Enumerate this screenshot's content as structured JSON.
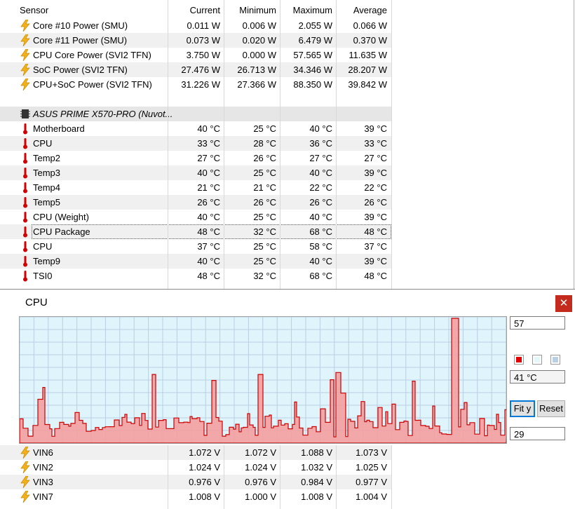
{
  "header": {
    "sensor": "Sensor",
    "current": "Current",
    "minimum": "Minimum",
    "maximum": "Maximum",
    "average": "Average"
  },
  "power_rows": [
    {
      "name": "Core #10 Power (SMU)",
      "current": "0.011 W",
      "minimum": "0.006 W",
      "maximum": "2.055 W",
      "average": "0.066 W",
      "icon": "lightning-icon"
    },
    {
      "name": "Core #11 Power (SMU)",
      "current": "0.073 W",
      "minimum": "0.020 W",
      "maximum": "6.479 W",
      "average": "0.370 W",
      "icon": "lightning-icon"
    },
    {
      "name": "CPU Core Power (SVI2 TFN)",
      "current": "3.750 W",
      "minimum": "0.000 W",
      "maximum": "57.565 W",
      "average": "11.635 W",
      "icon": "lightning-icon"
    },
    {
      "name": "SoC Power (SVI2 TFN)",
      "current": "27.476 W",
      "minimum": "26.713 W",
      "maximum": "34.346 W",
      "average": "28.207 W",
      "icon": "lightning-icon"
    },
    {
      "name": "CPU+SoC Power (SVI2 TFN)",
      "current": "31.226 W",
      "minimum": "27.366 W",
      "maximum": "88.350 W",
      "average": "39.842 W",
      "icon": "lightning-icon"
    }
  ],
  "group": {
    "name": "ASUS PRIME X570-PRO (Nuvot...",
    "icon": "chip-icon"
  },
  "temp_rows": [
    {
      "name": "Motherboard",
      "current": "40 °C",
      "minimum": "25 °C",
      "maximum": "40 °C",
      "average": "39 °C",
      "icon": "thermometer-icon"
    },
    {
      "name": "CPU",
      "current": "33 °C",
      "minimum": "28 °C",
      "maximum": "36 °C",
      "average": "33 °C",
      "icon": "thermometer-icon"
    },
    {
      "name": "Temp2",
      "current": "27 °C",
      "minimum": "26 °C",
      "maximum": "27 °C",
      "average": "27 °C",
      "icon": "thermometer-icon"
    },
    {
      "name": "Temp3",
      "current": "40 °C",
      "minimum": "25 °C",
      "maximum": "40 °C",
      "average": "39 °C",
      "icon": "thermometer-icon"
    },
    {
      "name": "Temp4",
      "current": "21 °C",
      "minimum": "21 °C",
      "maximum": "22 °C",
      "average": "22 °C",
      "icon": "thermometer-icon"
    },
    {
      "name": "Temp5",
      "current": "26 °C",
      "minimum": "26 °C",
      "maximum": "26 °C",
      "average": "26 °C",
      "icon": "thermometer-icon"
    },
    {
      "name": "CPU (Weight)",
      "current": "40 °C",
      "minimum": "25 °C",
      "maximum": "40 °C",
      "average": "39 °C",
      "icon": "thermometer-icon"
    },
    {
      "name": "CPU Package",
      "current": "48 °C",
      "minimum": "32 °C",
      "maximum": "68 °C",
      "average": "48 °C",
      "icon": "thermometer-icon"
    },
    {
      "name": "CPU",
      "current": "37 °C",
      "minimum": "25 °C",
      "maximum": "58 °C",
      "average": "37 °C",
      "icon": "thermometer-icon"
    },
    {
      "name": "Temp9",
      "current": "40 °C",
      "minimum": "25 °C",
      "maximum": "40 °C",
      "average": "39 °C",
      "icon": "thermometer-icon"
    },
    {
      "name": "TSI0",
      "current": "48 °C",
      "minimum": "32 °C",
      "maximum": "68 °C",
      "average": "48 °C",
      "icon": "thermometer-icon"
    }
  ],
  "graph": {
    "title": "CPU",
    "close": "✕",
    "max_value": "57",
    "current_value": "41 °C",
    "min_value": "29",
    "fit_y": "Fit y",
    "reset": "Reset",
    "colors": {
      "line": "#cc0000",
      "fill": "#f4a0a0",
      "background": "#dff4fb",
      "grid": "#b9cfe4"
    }
  },
  "voltage_rows": [
    {
      "name": "VIN6",
      "current": "1.072 V",
      "minimum": "1.072 V",
      "maximum": "1.088 V",
      "average": "1.073 V",
      "icon": "lightning-icon"
    },
    {
      "name": "VIN2",
      "current": "1.024 V",
      "minimum": "1.024 V",
      "maximum": "1.032 V",
      "average": "1.025 V",
      "icon": "lightning-icon"
    },
    {
      "name": "VIN3",
      "current": "0.976 V",
      "minimum": "0.976 V",
      "maximum": "0.984 V",
      "average": "0.977 V",
      "icon": "lightning-icon"
    },
    {
      "name": "VIN7",
      "current": "1.008 V",
      "minimum": "1.000 V",
      "maximum": "1.008 V",
      "average": "1.004 V",
      "icon": "lightning-icon"
    }
  ]
}
